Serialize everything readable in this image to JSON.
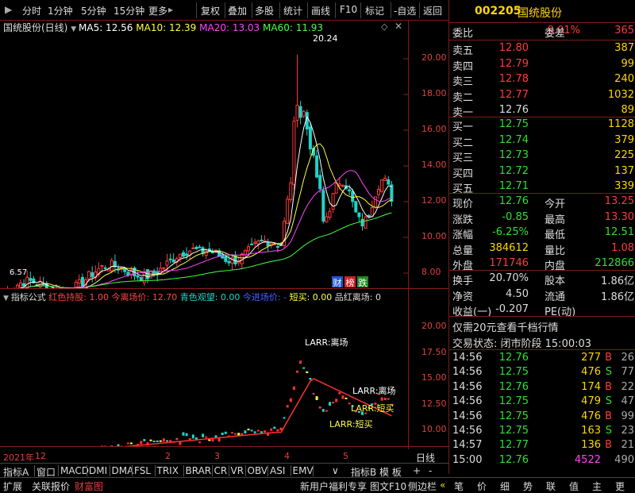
{
  "toolbar": {
    "items": [
      "分时",
      "1分钟",
      "5分钟",
      "15分钟",
      "更多"
    ],
    "more_arrow": "▸",
    "right_items": [
      "复权",
      "叠加",
      "多股",
      "统计",
      "画线",
      "F10",
      "标记",
      "-自选",
      "返回"
    ]
  },
  "main_chart": {
    "title": "国统股份(日线)",
    "ma5": "MA5: 12.56",
    "ma10": "MA10: 12.39",
    "ma20": "MA20: 13.03",
    "ma60": "MA60: 11.93",
    "peak_label": "20.24",
    "low_label": "6.57",
    "y_ticks": [
      "20.00",
      "18.00",
      "16.00",
      "14.00",
      "12.00",
      "10.00",
      "8.00"
    ],
    "badges": [
      "财",
      "榜",
      "跌"
    ]
  },
  "indicator": {
    "title": "指标公式",
    "label1": "红色持股: 1.00",
    "label2": "今离场价: 12.70",
    "label3": "青色观望: 0.00",
    "label4": "今进场价: -",
    "label5": "短买: 0.00",
    "label6": "品红离场: 0",
    "y_ticks": [
      "20.00",
      "17.50",
      "15.00",
      "12.50",
      "10.00"
    ],
    "annotations": [
      "LARR:离场",
      "LARR:离场",
      "LARR:短买",
      "LARR:短买",
      "LARR:离场",
      "LARR:短买",
      "LARR:短买"
    ]
  },
  "date_axis": {
    "year": "2021年",
    "months": [
      "12",
      "2",
      "3",
      "4",
      "5"
    ],
    "right": "日线"
  },
  "bottom_tabs": [
    "指标A",
    "窗口",
    "MACD",
    "DMI",
    "DMA",
    "FSL",
    "TRIX",
    "BRAR",
    "CR",
    "VR",
    "OBV",
    "ASI",
    "EMV"
  ],
  "bottom_tabs_more": "∨",
  "bottom_right_tabs": [
    "指标B",
    "模 板",
    "+",
    "-"
  ],
  "status_bar": {
    "left": [
      "扩展",
      "关联报价",
      "财富图"
    ],
    "middle": [
      "新用户福利专享",
      "图文F10",
      "侧边栏"
    ],
    "arrows": "«",
    "right": [
      "笔",
      "价",
      "细",
      "势",
      "联",
      "值",
      "主",
      "更"
    ]
  },
  "quote": {
    "code": "002205",
    "name": "国统股份",
    "weibi_label": "委比",
    "weibi": "9.01%",
    "weicha_label": "委差",
    "weicha": "365",
    "asks": [
      {
        "label": "卖五",
        "price": "12.80",
        "vol": "387"
      },
      {
        "label": "卖四",
        "price": "12.79",
        "vol": "99"
      },
      {
        "label": "卖三",
        "price": "12.78",
        "vol": "240"
      },
      {
        "label": "卖二",
        "price": "12.77",
        "vol": "1032"
      },
      {
        "label": "卖一",
        "price": "12.76",
        "vol": "89"
      }
    ],
    "bids": [
      {
        "label": "买一",
        "price": "12.75",
        "vol": "1128"
      },
      {
        "label": "买二",
        "price": "12.74",
        "vol": "379"
      },
      {
        "label": "买三",
        "price": "12.73",
        "vol": "225"
      },
      {
        "label": "买四",
        "price": "12.72",
        "vol": "137"
      },
      {
        "label": "买五",
        "price": "12.71",
        "vol": "339"
      }
    ],
    "stats": [
      {
        "l1": "现价",
        "v1": "12.76",
        "l2": "今开",
        "v2": "13.25"
      },
      {
        "l1": "涨跌",
        "v1": "-0.85",
        "l2": "最高",
        "v2": "13.30"
      },
      {
        "l1": "涨幅",
        "v1": "-6.25%",
        "l2": "最低",
        "v2": "12.51"
      },
      {
        "l1": "总量",
        "v1": "384612",
        "l2": "量比",
        "v2": "1.08"
      },
      {
        "l1": "外盘",
        "v1": "171746",
        "l2": "内盘",
        "v2": "212866"
      }
    ],
    "stats2": [
      {
        "l1": "换手",
        "v1": "20.70%",
        "l2": "股本",
        "v2": "1.86亿"
      },
      {
        "l1": "净资",
        "v1": "4.50",
        "l2": "流通",
        "v2": "1.86亿"
      },
      {
        "l1": "收益(一)",
        "v1": "-0.207",
        "l2": "PE(动)",
        "v2": ""
      }
    ],
    "promo": "仅需20元查看千档行情",
    "trade_status": "交易状态: 闭市阶段 15:00:03",
    "ticks": [
      {
        "t": "14:56",
        "p": "12.76",
        "v": "277",
        "bs": "B",
        "n": "26"
      },
      {
        "t": "14:56",
        "p": "12.75",
        "v": "476",
        "bs": "S",
        "n": "77"
      },
      {
        "t": "14:56",
        "p": "12.76",
        "v": "174",
        "bs": "B",
        "n": "22"
      },
      {
        "t": "14:56",
        "p": "12.75",
        "v": "479",
        "bs": "S",
        "n": "47"
      },
      {
        "t": "14:56",
        "p": "12.75",
        "v": "476",
        "bs": "B",
        "n": "99"
      },
      {
        "t": "14:56",
        "p": "12.75",
        "v": "163",
        "bs": "S",
        "n": "23"
      },
      {
        "t": "14:57",
        "p": "12.77",
        "v": "136",
        "bs": "B",
        "n": "21"
      },
      {
        "t": "15:00",
        "p": "12.76",
        "v": "4522",
        "bs": "",
        "n": "490"
      }
    ]
  },
  "colors": {
    "up": "#ff3b3b",
    "down": "#22d3c5",
    "ma5": "#ffffff",
    "ma10": "#ffff44",
    "ma20": "#ff44ff",
    "ma60": "#44ff44",
    "price_green": "#2fe02f",
    "accent_yellow": "#ffd700",
    "badge_red": "#e03030"
  }
}
